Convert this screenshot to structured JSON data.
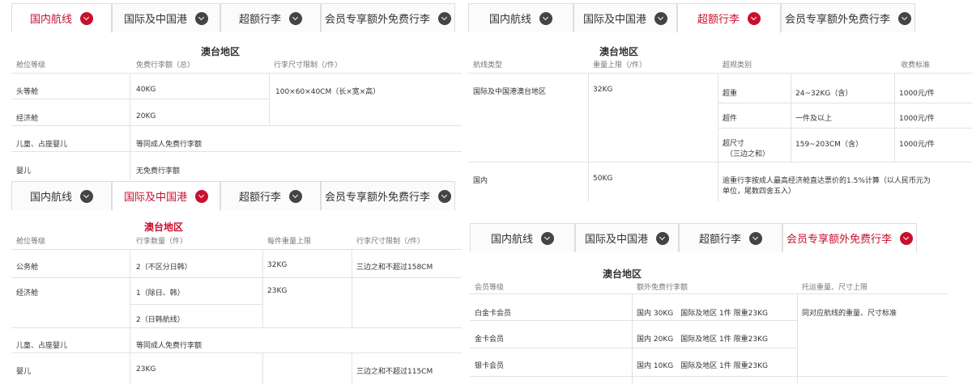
{
  "tabs": [
    "国内航线",
    "国际及中国港",
    "超额行李",
    "会员专享额外免费行李"
  ],
  "colors": {
    "accent": "#c8102e",
    "icon": "#444444",
    "border": "#e2e2e2"
  },
  "p1": {
    "region": "澳台地区",
    "headers": [
      "舱位等级",
      "免费行李额（总）",
      "行李尺寸限制（/件）"
    ],
    "rows": [
      [
        "头等舱",
        "40KG"
      ],
      [
        "经济舱",
        "20KG"
      ],
      [
        "儿童、占座婴儿",
        "等同成人免费行李额"
      ],
      [
        "婴儿",
        "无免费行李额"
      ]
    ],
    "size": "100×60×40CM（长×宽×高）"
  },
  "p2": {
    "region": "澳台地区",
    "headers": [
      "航线类型",
      "重量上限（/件）",
      "超规类别",
      "收费标准"
    ],
    "route1": "国际及中国港澳台地区",
    "route1_weight": "32KG",
    "rows": [
      [
        "超重",
        "24~32KG（含）",
        "1000元/件"
      ],
      [
        "超件",
        "一件及以上",
        "1000元/件"
      ],
      [
        "159~203CM（含）",
        "1000元/件"
      ]
    ],
    "oversize_l1": "超尺寸",
    "oversize_l2": "（三边之和）",
    "route2": "国内",
    "route2_weight": "50KG",
    "route2_note_l1": "逾重行李按成人最高经济舱直达票价的1.5%计算（以人民币元为",
    "route2_note_l2": "单位，尾数四舍五入）"
  },
  "p3": {
    "region": "澳台地区",
    "headers": [
      "舱位等级",
      "行李数量（件）",
      "每件重量上限",
      "行李尺寸限制（/件）"
    ],
    "r1": [
      "公务舱",
      "2（不区分日韩）",
      "32KG",
      "三边之和不超过158CM"
    ],
    "r2": [
      "经济舱",
      "1（除日、韩）",
      "23KG"
    ],
    "r2b": "2（日韩航线）",
    "r3": [
      "儿童、占座婴儿",
      "等同成人免费行李额"
    ],
    "r4": [
      "婴儿",
      "23KG",
      "三边之和不超过115CM"
    ]
  },
  "p4": {
    "region": "澳台地区",
    "headers": [
      "会员等级",
      "额外免费行李额",
      "托运重量、尺寸上限"
    ],
    "rows": [
      [
        "白金卡会员",
        "国内 30KG　国际及地区 1件 限重23KG"
      ],
      [
        "金卡会员",
        "国内 20KG　国际及地区 1件 限重23KG"
      ],
      [
        "银卡会员",
        "国内 10KG　国际及地区 1件 限重23KG"
      ]
    ],
    "limit": "同对应航线的重量、尺寸标准"
  }
}
